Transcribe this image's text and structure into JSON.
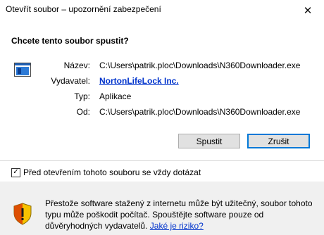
{
  "window": {
    "title": "Otevřít soubor – upozornění zabezpečení",
    "close_glyph": "✕"
  },
  "main": {
    "question": "Chcete tento soubor spustit?",
    "file_icon": "executable-window-icon",
    "fields": {
      "name_label": "Název:",
      "name_value": "C:\\Users\\patrik.ploc\\Downloads\\N360Downloader.exe",
      "publisher_label": "Vydavatel:",
      "publisher_value": "NortonLifeLock Inc.",
      "type_label": "Typ:",
      "type_value": "Aplikace",
      "from_label": "Od:",
      "from_value": "C:\\Users\\patrik.ploc\\Downloads\\N360Downloader.exe"
    },
    "buttons": {
      "run_label": "Spustit",
      "cancel_label": "Zrušit"
    }
  },
  "checkbox": {
    "label": "Před otevřením tohoto souboru se vždy dotázat",
    "checked": true,
    "check_glyph": "✓"
  },
  "warning": {
    "icon": "security-shield-icon",
    "text": "Přestože software stažený z internetu může být užitečný, soubor tohoto typu může poškodit počítač. Spouštějte software pouze od důvěryhodných vydavatelů.",
    "link_label": "Jaké je riziko?"
  },
  "colors": {
    "link": "#0033cc",
    "accent_border": "#0078d7",
    "panel_bg": "#f0f0f0",
    "shield_yellow": "#f6c200",
    "shield_red": "#d83b01"
  }
}
